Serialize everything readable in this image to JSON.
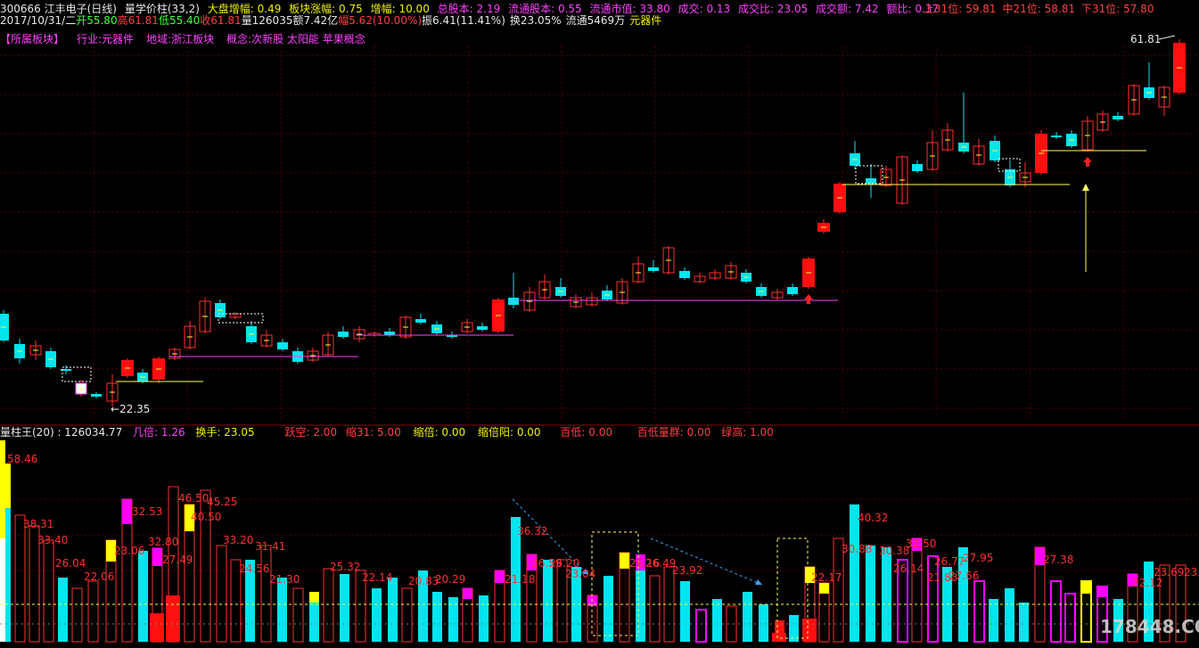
{
  "header": {
    "code_name": "300666 江丰电子(日线)",
    "indicator": "量学价柱(33,2)",
    "stats": [
      {
        "label": "大盘增幅:",
        "value": "0.49"
      },
      {
        "label": "板块涨幅:",
        "value": "0.75"
      },
      {
        "label": "增幅:",
        "value": "10.00"
      },
      {
        "label": "总股本:",
        "value": "2.19"
      },
      {
        "label": "流通股本:",
        "value": "0.55"
      },
      {
        "label": "流通市值:",
        "value": "33.80"
      },
      {
        "label": "成交:",
        "value": "0.13"
      },
      {
        "label": "成交比:",
        "value": "23.05"
      },
      {
        "label": "成交额:",
        "value": "7.42"
      },
      {
        "label": "额比:",
        "value": "0.37"
      }
    ],
    "levels": [
      "上31位: 59.81",
      "中21位: 58.81",
      "下31位: 57.80"
    ]
  },
  "quote": {
    "date": "2017/10/31/二",
    "open": "开55.80",
    "high": "高61.81",
    "low": "低55.40",
    "close": "收61.81",
    "volume": "量126035",
    "amount": "额7.42亿",
    "change": "幅5.62(10.00%)",
    "amplitude": "振6.41(11.41%)",
    "turnover": "换23.05%",
    "float": "流通5469万",
    "sector": "元器件"
  },
  "sector_line": {
    "title": "【所属板块】",
    "industry": "行业:元器件",
    "region": "地域:浙江板块",
    "concept": "概念:次新股 太阳能 苹果概念"
  },
  "price_chart": {
    "high_label": "61.81",
    "low_label": "←22.35"
  },
  "volume_header": {
    "title": "量柱王(20) : 126034.77",
    "items": [
      {
        "text": "几倍: 1.26",
        "color": "#ff40ff"
      },
      {
        "text": "换手: 23.05",
        "color": "#f0f000"
      },
      {
        "text": "跃空: 2.00",
        "color": "#ff4040"
      },
      {
        "text": "缩31: 5.00",
        "color": "#ff4040"
      },
      {
        "text": "缩倍: 0.00",
        "color": "#f0f000"
      },
      {
        "text": "缩倍阳: 0.00",
        "color": "#f0f000"
      },
      {
        "text": "百低: 0.00",
        "color": "#ff4040"
      },
      {
        "text": "百低量群: 0.00",
        "color": "#ff4040"
      },
      {
        "text": "绿高: 1.00",
        "color": "#ff4040"
      }
    ]
  },
  "volume_labels": [
    "58.46",
    "38.31",
    "33.40",
    "26.04",
    "22.06",
    "23.06",
    "32.53",
    "32.80",
    "27.49",
    "46.50",
    "40.50",
    "45.25",
    "33.20",
    "24.56",
    "31.41",
    "21.30",
    "25.32",
    "22.14",
    "20.83",
    "20.29",
    "21.18",
    "36.32",
    "26.59",
    "26.20",
    "23.04",
    "26.16",
    "26.49",
    "23.92",
    "22.17",
    "30.88",
    "40.32",
    "30.38",
    "26.14",
    "32.50",
    "21.83",
    "26.77",
    "27.95",
    "27.66",
    "27.38",
    "22.12",
    "23.69",
    "23.0"
  ],
  "watermark": "178448.COM",
  "colors": {
    "up": "#ff3030",
    "down": "#00e5ee",
    "magenta": "#ff00ff",
    "yellow": "#ffff00",
    "text": "#e8e8e8"
  }
}
